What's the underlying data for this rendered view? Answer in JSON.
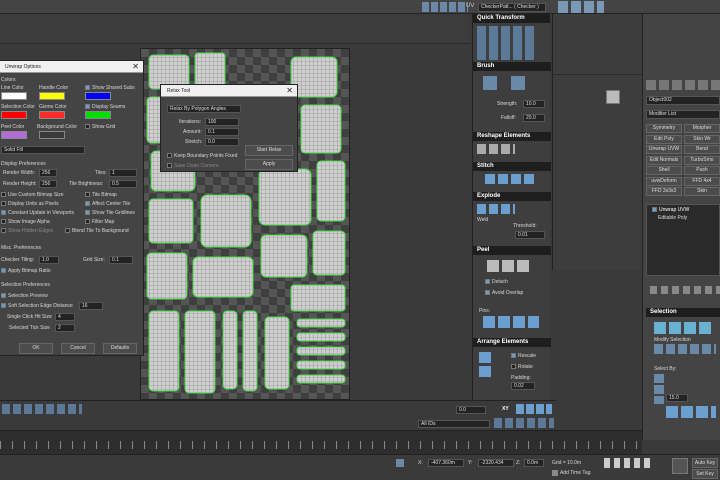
{
  "toolbar": {
    "checker_label": "CheckerPatt... ( Checker )",
    "uv_label": "UV"
  },
  "unwrap_options": {
    "title": "Unwrap Options",
    "colors_label": "Colors",
    "line_color": "Line Color",
    "handle_color": "Handle Color",
    "show_shared_subs": "Show Shared Subs",
    "selection_color": "Selection Color",
    "gizmo_color": "Gizmo Color",
    "display_seams": "Display Seams",
    "peel_color": "Peel Color",
    "background_color": "Background Color",
    "show_grid": "Show Grid",
    "fill_mode": "Solid Fill",
    "display_prefs": "Display Preferences",
    "render_width_label": "Render Width:",
    "render_width": "256",
    "tiles_label": "Tiles:",
    "tiles": "1",
    "render_height_label": "Render Height:",
    "render_height": "256",
    "tile_brightness_label": "Tile Brightness:",
    "tile_brightness": "0.5",
    "use_custom_bitmap": "Use Custom Bitmap Size",
    "tile_bitmap": "Tile Bitmap",
    "display_units_pixels": "Display Units as Pixels",
    "affect_center_tile": "Affect Center Tile",
    "constant_update": "Constant Update in Viewports",
    "show_tile_gridlines": "Show Tile Gridlines",
    "show_image_alpha": "Show Image Alpha",
    "filter_map": "Filter Map",
    "show_hidden_edges": "Show Hidden Edges",
    "blend_tile": "Blend Tile To Background",
    "misc_prefs": "Misc. Preferences",
    "checker_tiling_label": "Checker Tiling:",
    "checker_tiling": "1.0",
    "grid_size_label": "Grid Size:",
    "grid_size": "0.1",
    "apply_bitmap_ratio": "Apply Bitmap Ratio",
    "selection_prefs": "Selection Preferences",
    "selection_preview": "Selection Preview",
    "soft_sel_edge_label": "Soft Selection Edge Distance",
    "soft_sel_edge": "16",
    "single_click_label": "Single Click Hit Size",
    "single_click": "4",
    "selected_tick_label": "Selected Tick Size",
    "selected_tick": "2",
    "ok": "OK",
    "cancel": "Cancel",
    "defaults": "Defaults"
  },
  "relax_tool": {
    "title": "Relax Tool",
    "method": "Relax By Polygon Angles",
    "iterations_label": "Iterations:",
    "iterations": "100",
    "amount_label": "Amount:",
    "amount": "0.1",
    "stretch_label": "Stretch:",
    "stretch": "0.0",
    "keep_boundary": "Keep Boundary Points Fixed",
    "save_outer": "Save Outer Corners",
    "start_relax": "Start Relax",
    "apply": "Apply"
  },
  "panel": {
    "quick_transform": "Quick Transform",
    "brush": "Brush",
    "strength_label": "Strength:",
    "strength": "10.0",
    "falloff_label": "Falloff:",
    "falloff": "20.0",
    "reshape": "Reshape Elements",
    "stitch": "Stitch",
    "explode": "Explode",
    "weld_label": "Weld",
    "threshold_label": "Threshold:",
    "threshold": "0.01",
    "peel": "Peel",
    "detach": "Detach",
    "avoid_overlap": "Avoid Overlap",
    "pins_label": "Pins:",
    "arrange": "Arrange Elements",
    "rescale": "Rescale",
    "rotate": "Rotate",
    "padding_label": "Padding:",
    "padding": "0.02"
  },
  "modifier": {
    "object_name": "Object002",
    "modifier_list": "Modifier List",
    "buttons": [
      "Symmetry",
      "Morpher",
      "Edit Poly",
      "Skin Wr",
      "Unwrap UVW",
      "Bend",
      "Edit Normals",
      "TurboSmo",
      "Shell",
      "Push",
      "uvwDeform (WSM)",
      "FFD 4x4",
      "FFD 3x3x3",
      "Skin"
    ],
    "stack": [
      "Unwrap UVW",
      "Editable Poly"
    ],
    "selection_header": "Selection",
    "modify_selection": "Modify Selection",
    "select_by": "Select By:",
    "value": "15.0"
  },
  "bottom": {
    "coord_value": "0.0",
    "xy": "XY",
    "all_ids": "All IDs",
    "x_label": "X:",
    "x_value": "-407.360m",
    "y_label": "Y:",
    "y_value": "-2320.434",
    "z_label": "Z:",
    "z_value": "0.0m",
    "grid": "Grid = 10.0m",
    "add_time_tag": "Add Time Tag",
    "auto_key": "Auto Key",
    "set_key": "Set Key"
  }
}
